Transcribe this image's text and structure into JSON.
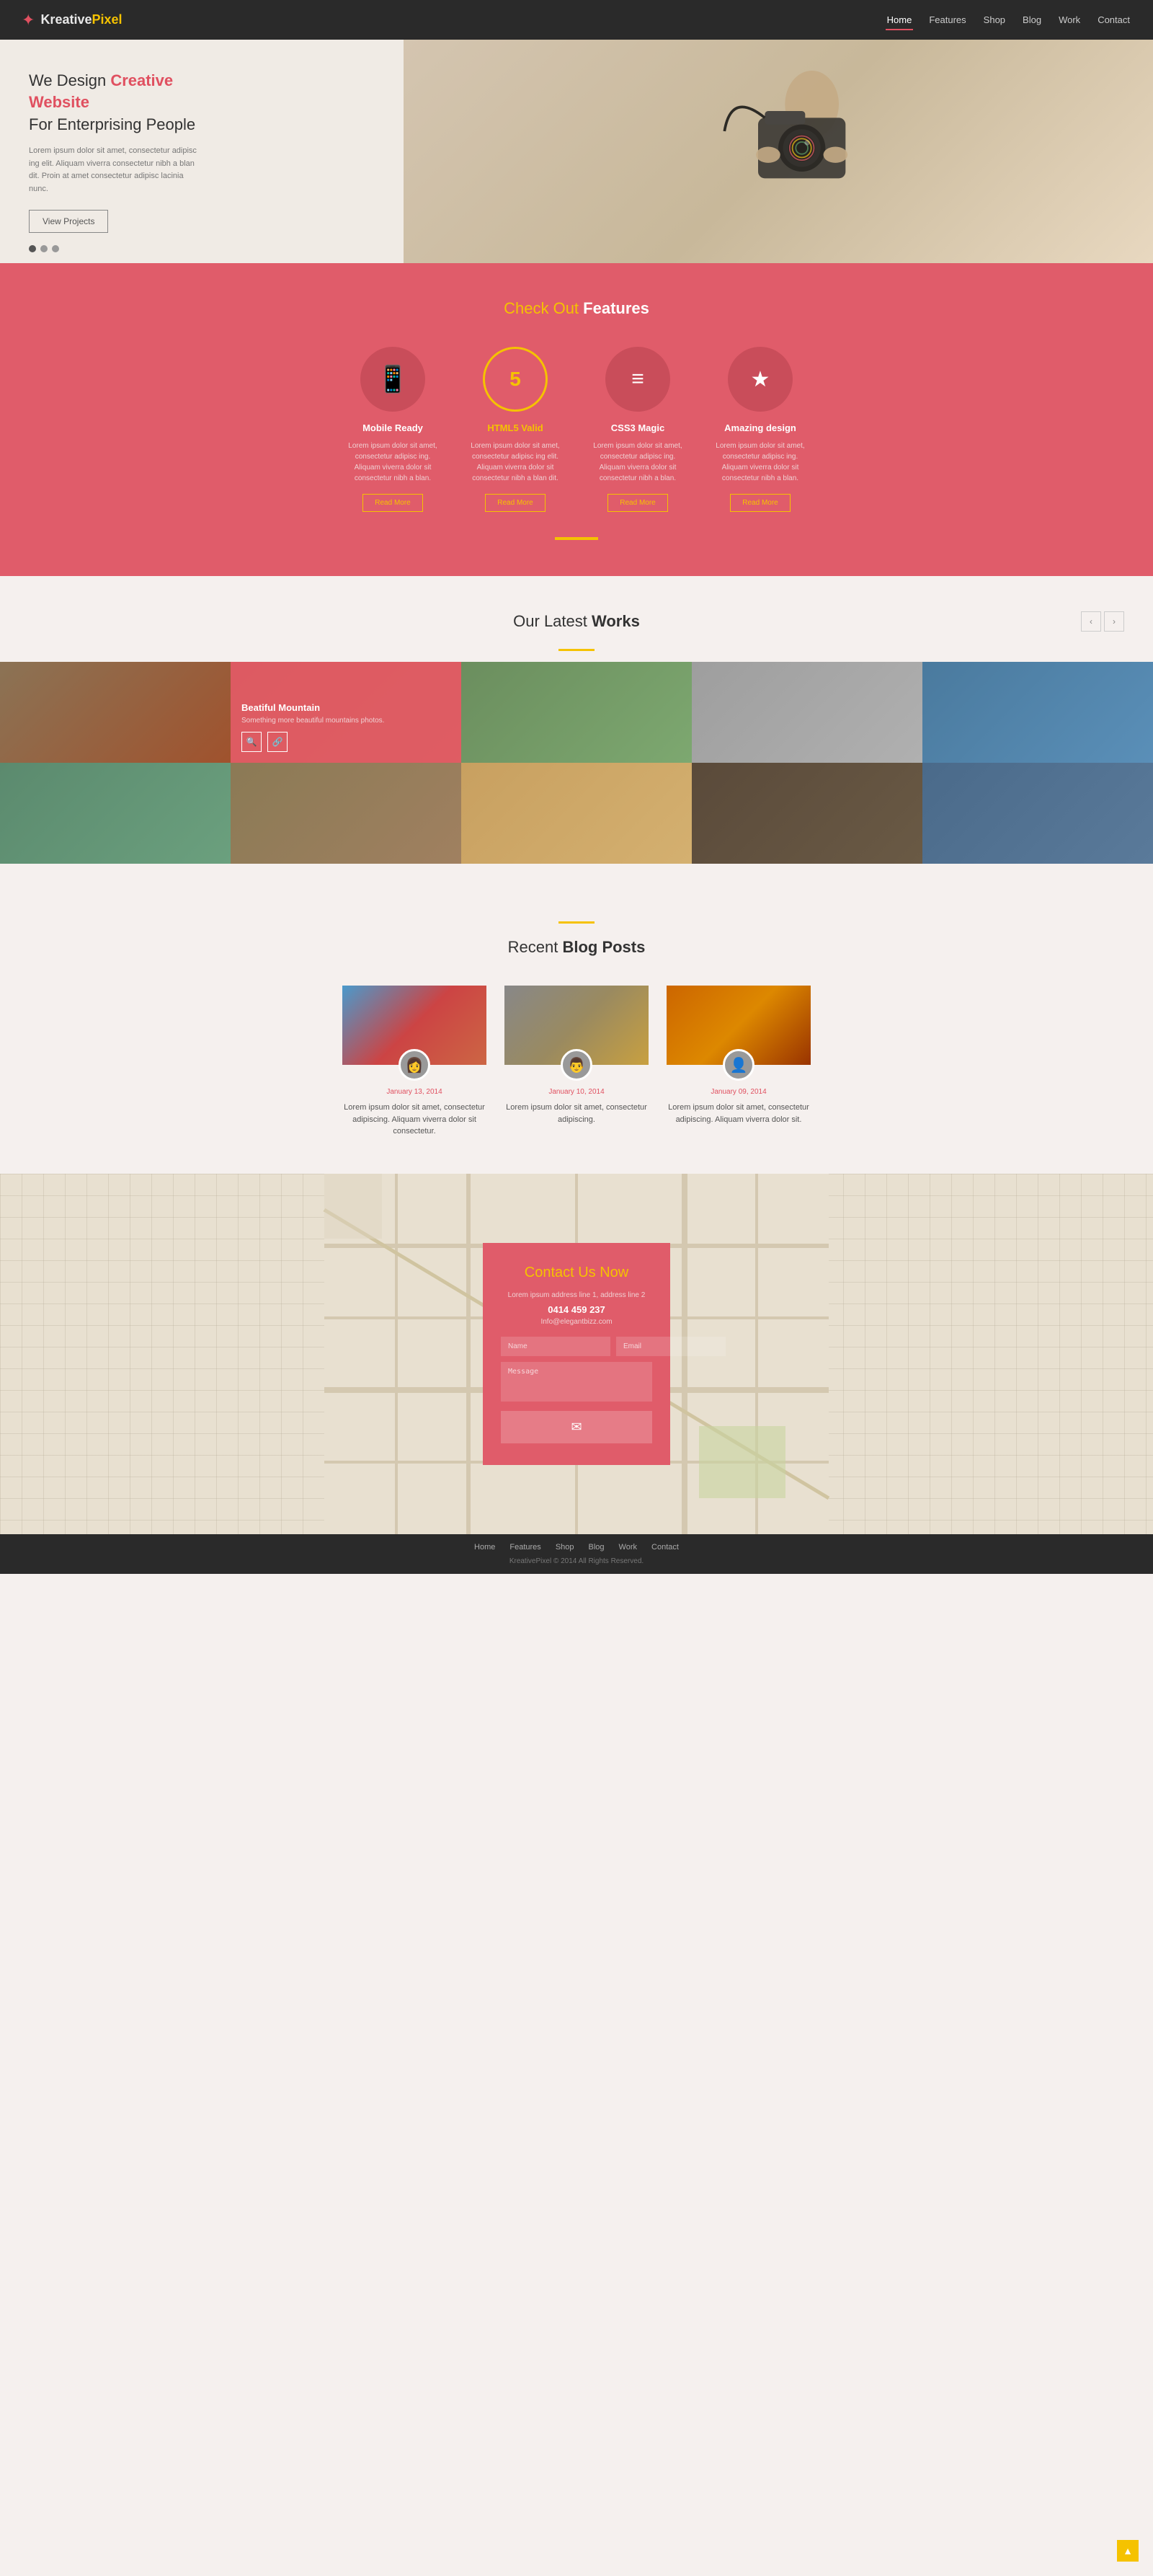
{
  "navbar": {
    "logo_kreative": "Kreative",
    "logo_pixel": "Pixel",
    "nav_items": [
      {
        "label": "Home",
        "active": true
      },
      {
        "label": "Features",
        "active": false
      },
      {
        "label": "Shop",
        "active": false
      },
      {
        "label": "Blog",
        "active": false
      },
      {
        "label": "Work",
        "active": false
      },
      {
        "label": "Contact",
        "active": false
      }
    ]
  },
  "hero": {
    "title_line1": "We Design ",
    "title_creative": "Creative Website",
    "title_line2": "For Enterprising People",
    "desc": "Lorem ipsum dolor sit amet, consectetur adipisc ing elit. Aliquam viverra consectetur nibh a blan dit. Proin at amet consectetur adipisc lacinia nunc.",
    "btn_label": "View Projects",
    "dots": [
      true,
      false,
      false
    ]
  },
  "features": {
    "section_title_prefix": "Check Out ",
    "section_title_suffix": "Features",
    "cards": [
      {
        "icon": "📱",
        "title": "Mobile Ready",
        "desc": "Lorem ipsum dolor sit amet, consectetur adipisc ing. Aliquam viverra  dolor sit consectetur nibh a blan.",
        "btn": "Read More",
        "highlight": false
      },
      {
        "icon": "5",
        "title": "HTML5 Valid",
        "desc": "Lorem ipsum dolor sit amet, consectetur adipisc ing elit. Aliquam viverra  dolor sit consectetur nibh a blan dit.",
        "btn": "Read More",
        "highlight": true
      },
      {
        "icon": "≡",
        "title": "CSS3 Magic",
        "desc": "Lorem ipsum dolor sit amet, consectetur adipisc ing. Aliquam viverra  dolor sit consectetur nibh a blan.",
        "btn": "Read More",
        "highlight": false
      },
      {
        "icon": "★",
        "title": "Amazing design",
        "desc": "Lorem ipsum dolor sit amet, consectetur adipisc ing. Aliquam viverra  dolor sit consectetur nibh a blan.",
        "btn": "Read More",
        "highlight": false
      }
    ]
  },
  "works": {
    "title_prefix": "Our Latest ",
    "title_suffix": "Works",
    "items": [
      {
        "overlay": false,
        "class": "w1"
      },
      {
        "overlay": true,
        "title": "Beatiful Mountain",
        "desc": "Something more beautiful mountains photos.",
        "class": "w2"
      },
      {
        "overlay": false,
        "class": "w3"
      },
      {
        "overlay": false,
        "class": "w4"
      },
      {
        "overlay": false,
        "class": "w5"
      },
      {
        "overlay": false,
        "class": "w6"
      },
      {
        "overlay": false,
        "class": "w7"
      },
      {
        "overlay": false,
        "class": "w8"
      },
      {
        "overlay": false,
        "class": "w9"
      },
      {
        "overlay": false,
        "class": "w10"
      }
    ]
  },
  "blog": {
    "title_prefix": "Recent ",
    "title_suffix": "Blog Posts",
    "posts": [
      {
        "date": "January 13, 2014",
        "text": "Lorem ipsum dolor sit amet, consectetur adipiscing. Aliquam viverra  dolor sit consectetur.",
        "img_class": "blog-img1"
      },
      {
        "date": "January 10, 2014",
        "text": "Lorem ipsum dolor sit amet, consectetur adipiscing.",
        "img_class": "blog-img2"
      },
      {
        "date": "January 09, 2014",
        "text": "Lorem ipsum dolor sit amet, consectetur adipiscing. Aliquam viverra  dolor sit.",
        "img_class": "blog-img3"
      }
    ]
  },
  "contact": {
    "title": "Contact Us Now",
    "address1": "Lorem ipsum address line 1, address line 2",
    "phone": "0414 459 237",
    "email": "Info@elegantbizz.com",
    "name_placeholder": "Name",
    "email_placeholder": "Email",
    "message_placeholder": "Message"
  },
  "footer": {
    "nav_items": [
      "Home",
      "Features",
      "Shop",
      "Blog",
      "Work",
      "Contact"
    ],
    "copyright": "KreativePixel © 2014 All Rights Reserved."
  }
}
